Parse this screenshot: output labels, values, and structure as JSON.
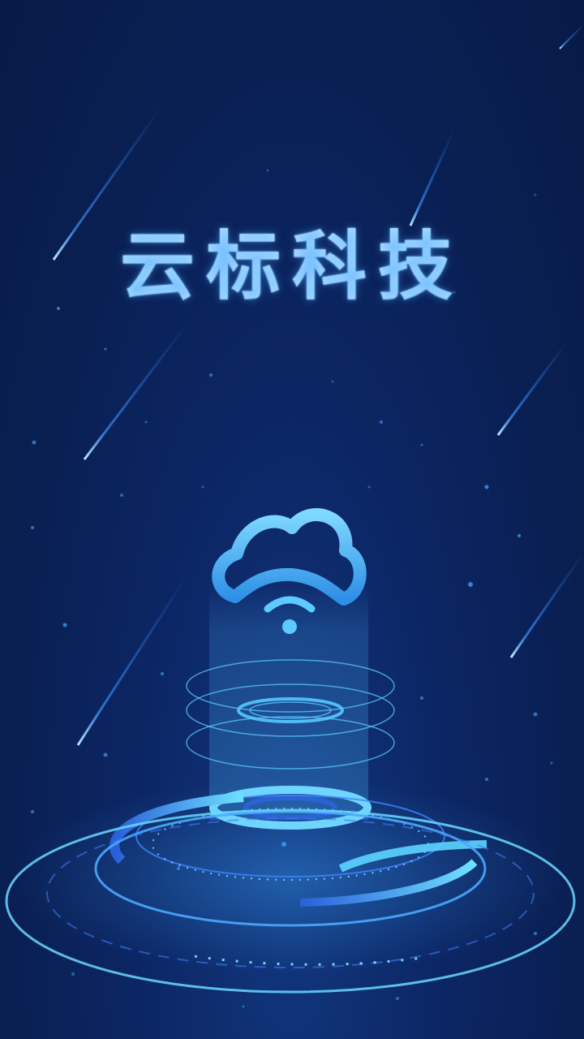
{
  "splash": {
    "brand_title": "云标科技"
  },
  "icons": {
    "logo": "cloud-wifi-icon"
  },
  "colors": {
    "background_dark": "#081a47",
    "background_mid": "#0c2766",
    "accent_cyan": "#5bd0f5",
    "accent_blue": "#2e6fe0",
    "title_light": "#8fd6ff"
  }
}
